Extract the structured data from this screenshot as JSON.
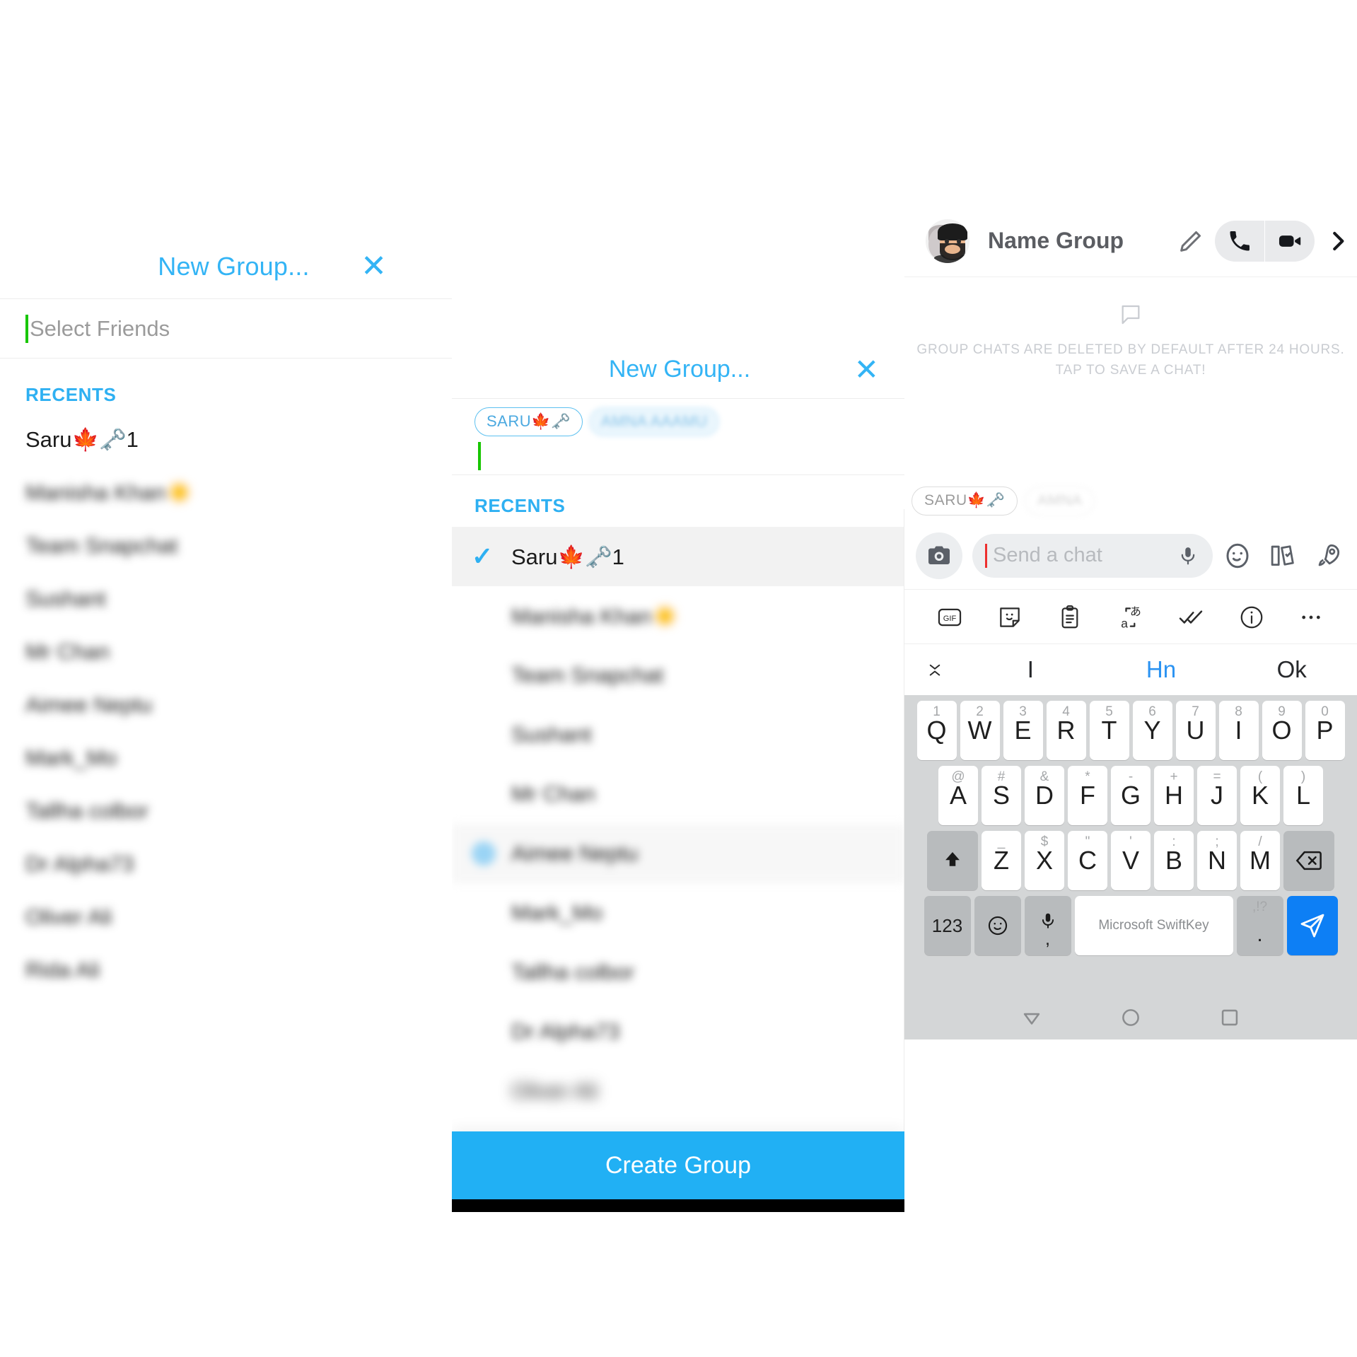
{
  "panel_left": {
    "title": "New Group...",
    "close_icon_glyph": "✕",
    "search_placeholder": "Select Friends",
    "recents_label": "RECENTS",
    "friends": [
      {
        "name": "Saru🍁🗝️1",
        "blurred": false
      },
      {
        "name": "Manisha Khan☀️",
        "blurred": true
      },
      {
        "name": "Team Snapchat",
        "blurred": true
      },
      {
        "name": "Sushant",
        "blurred": true
      },
      {
        "name": "Mr Chan",
        "blurred": true
      },
      {
        "name": "Aimee Neptu",
        "blurred": true
      },
      {
        "name": "Mark_Mo",
        "blurred": true
      },
      {
        "name": "Tallha colbor",
        "blurred": true
      },
      {
        "name": "Dr Alpha73",
        "blurred": true
      },
      {
        "name": "Oliver Ali",
        "blurred": true
      },
      {
        "name": "Rida Ali",
        "blurred": true
      }
    ]
  },
  "panel_mid": {
    "title": "New Group...",
    "close_icon_glyph": "✕",
    "recents_label": "RECENTS",
    "check_glyph": "✓",
    "selected_pills": [
      {
        "label": "SARU🍁🗝️"
      },
      {
        "label": "AMNA AAAMU"
      }
    ],
    "friends": [
      {
        "name": "Saru🍁🗝️1",
        "selected": true
      },
      {
        "name": "Manisha Khan☀️",
        "selected": false
      },
      {
        "name": "Team Snapchat",
        "selected": false
      },
      {
        "name": "Sushant",
        "selected": false
      },
      {
        "name": "Mr Chan",
        "selected": false
      },
      {
        "name": "Aimee Neptu",
        "selected": false
      },
      {
        "name": "Mark_Mo",
        "selected": false
      },
      {
        "name": "Tallha colbor",
        "selected": false
      },
      {
        "name": "Dr Alpha73",
        "selected": false
      },
      {
        "name": "Oliver Ali",
        "selected": false
      }
    ],
    "create_button_label": "Create Group"
  },
  "panel_right": {
    "group_name": "Name Group",
    "notice_line_1": "GROUP CHATS ARE DELETED BY DEFAULT AFTER 24 HOURS.",
    "notice_line_2": "TAP TO SAVE A CHAT!",
    "member_pills": [
      {
        "label": "SARU🍁🗝️"
      },
      {
        "label": "AMNA"
      }
    ],
    "chat_placeholder": "Send a chat",
    "keyboard": {
      "suggestions": [
        "I",
        "Hn",
        "Ok"
      ],
      "row1": [
        {
          "sup": "1",
          "key": "Q"
        },
        {
          "sup": "2",
          "key": "W"
        },
        {
          "sup": "3",
          "key": "E"
        },
        {
          "sup": "4",
          "key": "R"
        },
        {
          "sup": "5",
          "key": "T"
        },
        {
          "sup": "6",
          "key": "Y"
        },
        {
          "sup": "7",
          "key": "U"
        },
        {
          "sup": "8",
          "key": "I"
        },
        {
          "sup": "9",
          "key": "O"
        },
        {
          "sup": "0",
          "key": "P"
        }
      ],
      "row2": [
        {
          "sup": "@",
          "key": "A"
        },
        {
          "sup": "#",
          "key": "S"
        },
        {
          "sup": "&",
          "key": "D"
        },
        {
          "sup": "*",
          "key": "F"
        },
        {
          "sup": "-",
          "key": "G"
        },
        {
          "sup": "+",
          "key": "H"
        },
        {
          "sup": "=",
          "key": "J"
        },
        {
          "sup": "(",
          "key": "K"
        },
        {
          "sup": ")",
          "key": "L"
        }
      ],
      "row3": [
        {
          "sup": "_",
          "key": "Z"
        },
        {
          "sup": "$",
          "key": "X"
        },
        {
          "sup": "\"",
          "key": "C"
        },
        {
          "sup": "'",
          "key": "V"
        },
        {
          "sup": ":",
          "key": "B"
        },
        {
          "sup": ";",
          "key": "N"
        },
        {
          "sup": "/",
          "key": "M"
        }
      ],
      "numeric_key": "123",
      "comma_key": ",",
      "spacebar_label": "Microsoft SwiftKey",
      "punct_sup": ",!?",
      "period_key": "."
    }
  }
}
